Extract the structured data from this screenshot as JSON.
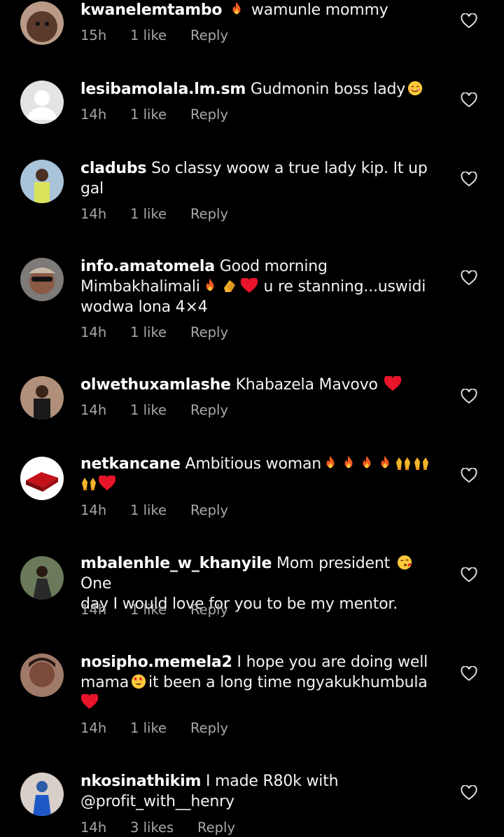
{
  "comments": [
    {
      "username": "kwanelemtambo",
      "text": "wamunle mommy",
      "time": "15h",
      "likes": "1 like",
      "reply": "Reply"
    },
    {
      "username": "lesibamolala.lm.sm",
      "text": "Gudmonin boss lady",
      "time": "14h",
      "likes": "1 like",
      "reply": "Reply"
    },
    {
      "username": "cladubs",
      "text": "So classy woow a true lady kip. It up",
      "text2": "gal",
      "time": "14h",
      "likes": "1 like",
      "reply": "Reply"
    },
    {
      "username": "info.amatomela",
      "text": "Good  morning",
      "text2": "Mimbakhalimali",
      "text3": "u re stanning...uswidi",
      "text4": "wodwa lona 4×4",
      "time": "14h",
      "likes": "1 like",
      "reply": "Reply"
    },
    {
      "username": "olwethuxamlashe",
      "text": "Khabazela Mavovo",
      "time": "14h",
      "likes": "1 like",
      "reply": "Reply"
    },
    {
      "username": "netkancane",
      "text": "Ambitious woman",
      "time": "14h",
      "likes": "1 like",
      "reply": "Reply"
    },
    {
      "username": "mbalenhle_w_khanyile",
      "text": "Mom president",
      "text2": "One",
      "text3": "day I would love for you to be my mentor.",
      "time": "14h",
      "likes": "1 like",
      "reply": "Reply"
    },
    {
      "username": "nosipho.memela2",
      "text": "I hope you are doing well",
      "text2": "mama",
      "text3": "it been a long time ngyakukhumbula",
      "time": "14h",
      "likes": "1 like",
      "reply": "Reply"
    },
    {
      "username": "nkosinathikim",
      "text": "I made R80k with",
      "text2": "@profit_with__henry",
      "time": "14h",
      "likes": "3 likes",
      "reply": "Reply"
    }
  ],
  "icons": {
    "like": "heart-outline-icon"
  }
}
